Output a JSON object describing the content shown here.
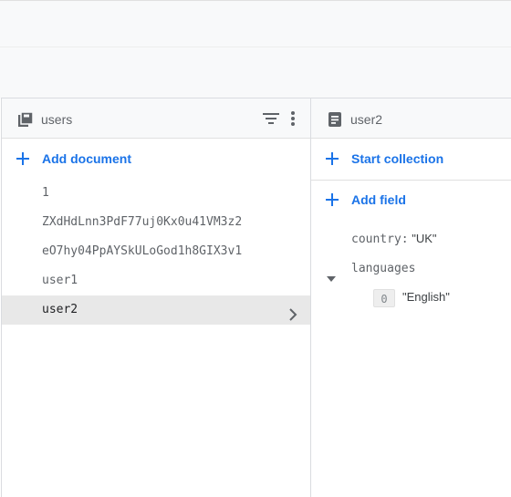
{
  "collection_panel": {
    "title": "users",
    "add_document_label": "Add document",
    "documents": [
      {
        "id": "1"
      },
      {
        "id": "ZXdHdLnn3PdF77uj0Kx0u41VM3z2"
      },
      {
        "id": "eO7hy04PpAYSkULoGod1h8GIX3v1"
      },
      {
        "id": "user1"
      },
      {
        "id": "user2",
        "selected": true
      }
    ]
  },
  "document_panel": {
    "title": "user2",
    "start_collection_label": "Start collection",
    "add_field_label": "Add field",
    "fields": {
      "country": {
        "key": "country:",
        "value": "\"UK\""
      },
      "languages": {
        "key": "languages",
        "items": [
          {
            "index": "0",
            "value": "\"English\""
          }
        ]
      }
    }
  },
  "colors": {
    "accent": "#1a73e8",
    "selected_row": "#e8e8e8",
    "muted_text": "#5f6368"
  },
  "icons": [
    "collection-icon",
    "filter-icon",
    "more-vert-icon",
    "add-icon",
    "chevron-right-icon",
    "document-icon",
    "caret-down-icon"
  ]
}
